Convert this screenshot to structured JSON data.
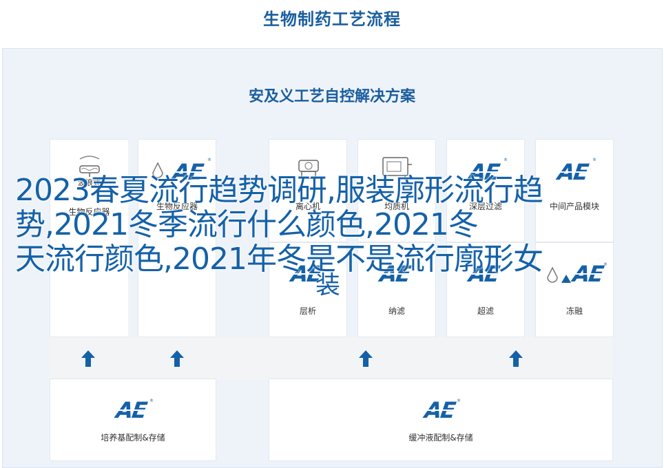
{
  "page_title": "生物制药工艺流程",
  "panel_title": "安及义工艺自控解决方案",
  "logo_text": "AE",
  "logo_mark": "®",
  "top_cards": [
    {
      "label": "生物反应器",
      "sublabel": "波浪式",
      "icon": "bioreactor-icon"
    },
    {
      "label": "生物反应器",
      "icon": "droplet-icon"
    },
    {
      "label": "离心机",
      "icon": "centrifuge-icon"
    },
    {
      "label": "均质机",
      "icon": "homogenizer-icon"
    },
    {
      "label": "深层过滤",
      "icon": "ae-logo"
    },
    {
      "label": "中间产品模块",
      "icon": "ae-logo"
    }
  ],
  "middle_cards": [
    {
      "label": "层析"
    },
    {
      "label": "纳滤"
    },
    {
      "label": "超滤"
    },
    {
      "label": "冻融"
    }
  ],
  "bottom_cards": [
    {
      "label": "培养基配制&存储"
    },
    {
      "label": "缓冲液配制&存储"
    }
  ],
  "overlay": {
    "line1": "2023春夏流行趋势调研,服装廓形流行趋",
    "line2": "势,2021冬季流行什么颜色,2021冬",
    "line3": "天流行颜色,2021年冬是不是流行廓形女",
    "line4": "装"
  },
  "colors": {
    "title": "#1b5e9e",
    "brand": "#1561a8",
    "panel_bg": "#eef3fa"
  }
}
